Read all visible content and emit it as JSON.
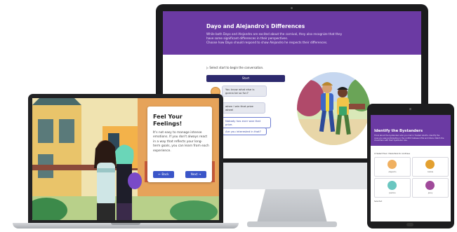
{
  "imac": {
    "title": "Dayo and Alejandro's Differences",
    "description_lines": [
      "While both Dayo and Alejandro are excited about the carnival, they also recognize that they",
      "have some significant differences in their perspectives.",
      "Choose how Dayo should respond to show Alejandro he respects their differences."
    ],
    "hint": "Select start to begin the conversation.",
    "start_label": "Start",
    "chat": [
      {
        "text": "You know what else is gonna be so fun?",
        "type": "msg"
      },
      {
        "text": "when I win that prize wheel",
        "type": "msg"
      },
      {
        "text": "Nobody has ever won that prize.",
        "type": "opt"
      },
      {
        "text": "Are you interested in that?",
        "type": "opt"
      }
    ]
  },
  "laptop": {
    "card_title": "Feel Your Feelings!",
    "card_body": "It's not easy to manage intense emotions. If you don't always react in a way that reflects your long-term goals, you can learn from each experience.",
    "back_label": "← Back",
    "next_label": "Next →"
  },
  "tablet": {
    "title": "Identify the Bystanders",
    "description": "Think about the bystanders who you met in Trusted Adult's. Identify the ones you saw participating in the conflict between Ella and Olivia. Match the characters with their bystander role.",
    "select_hint": "Select four characters to continue",
    "characters": [
      {
        "name": "Alejandro"
      },
      {
        "name": "Camila"
      },
      {
        "name": "Jasmine"
      },
      {
        "name": "Jenny"
      }
    ],
    "footer": "Selected"
  },
  "colors": {
    "purple": "#6b3aa3",
    "navy": "#2d2a6e",
    "button_blue": "#3a55c8"
  }
}
